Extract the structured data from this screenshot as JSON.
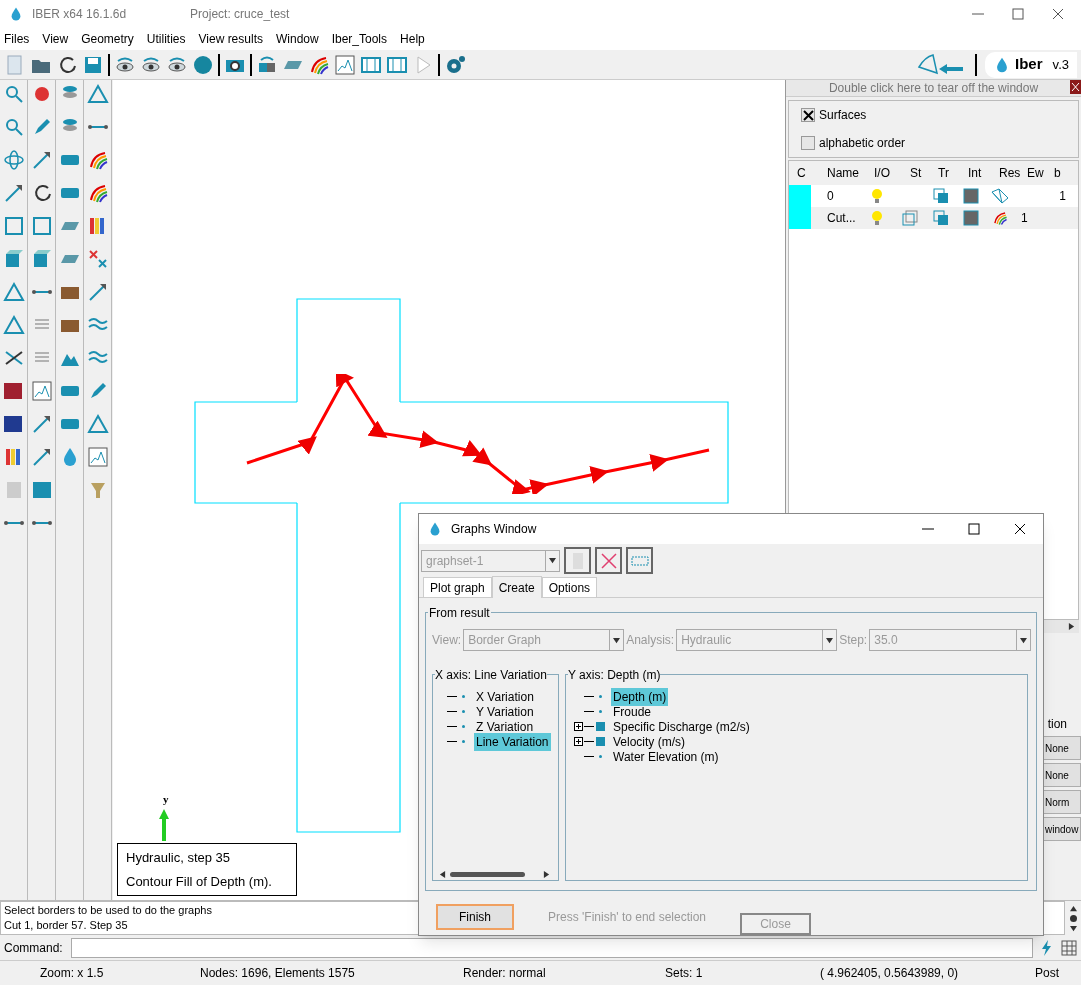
{
  "app": {
    "title": "IBER x64 16.1.6d",
    "project": "Project: cruce_test"
  },
  "menu": [
    "Files",
    "View",
    "Geometry",
    "Utilities",
    "View results",
    "Window",
    "Iber_Tools",
    "Help"
  ],
  "logo": {
    "name": "Iber",
    "version": "v.3"
  },
  "layers_panel": {
    "tear_off": "Double click here to tear off the window",
    "surfaces": {
      "label": "Surfaces",
      "checked": true
    },
    "alphabetic": {
      "label": "alphabetic order",
      "checked": false
    },
    "columns": [
      "C",
      "Name",
      "I/O",
      "St",
      "Tr",
      "Int",
      "Res",
      "Ew",
      "b"
    ],
    "rows": [
      {
        "color": "#00ffff",
        "name": "0",
        "style_icon": false,
        "kind": "mesh",
        "ew": "",
        "b": "1"
      },
      {
        "color": "#00ffff",
        "name": "Cut...",
        "style_icon": true,
        "kind": "rainbow",
        "ew": "1",
        "b": ""
      }
    ],
    "side_label": "tion",
    "side_buttons": [
      "None",
      "None",
      "Norm",
      "window"
    ]
  },
  "canvas": {
    "axis_label": "y",
    "legend": [
      "Hydraulic, step 35",
      "Contour Fill of Depth (m)."
    ]
  },
  "graphs_window": {
    "title": "Graphs Window",
    "graphset": "graphset-1",
    "tabs": [
      {
        "label": "Plot graph",
        "selected": false
      },
      {
        "label": "Create",
        "selected": true
      },
      {
        "label": "Options",
        "selected": false
      }
    ],
    "group": "From result",
    "view": {
      "label": "View:",
      "value": "Border Graph"
    },
    "analysis": {
      "label": "Analysis:",
      "value": "Hydraulic"
    },
    "step": {
      "label": "Step:",
      "value": "35.0"
    },
    "x_axis": {
      "title": "X axis: Line Variation",
      "items": [
        {
          "label": "X Variation",
          "selected": false,
          "kind": "leaf"
        },
        {
          "label": "Y Variation",
          "selected": false,
          "kind": "leaf"
        },
        {
          "label": "Z Variation",
          "selected": false,
          "kind": "leaf"
        },
        {
          "label": "Line Variation",
          "selected": true,
          "kind": "leaf"
        }
      ]
    },
    "y_axis": {
      "title": "Y axis: Depth (m)",
      "items": [
        {
          "label": "Depth (m)",
          "selected": true,
          "kind": "leaf"
        },
        {
          "label": "Froude",
          "selected": false,
          "kind": "leaf"
        },
        {
          "label": "Specific Discharge (m2/s)",
          "selected": false,
          "kind": "group",
          "expanded": false
        },
        {
          "label": "Velocity (m/s)",
          "selected": false,
          "kind": "group",
          "expanded": false
        },
        {
          "label": "Water Elevation (m)",
          "selected": false,
          "kind": "leaf"
        }
      ]
    },
    "finish": "Finish",
    "hint": "Press 'Finish' to end selection",
    "close": "Close"
  },
  "messages": [
    "Select borders to be used to do the graphs",
    "Cut 1, border 57. Step 35"
  ],
  "command": {
    "label": "Command:"
  },
  "status": [
    "Zoom: x 1.5",
    "Nodes: 1696, Elements 1575",
    "Render: normal",
    "Sets: 1",
    "(  4.962405,  0.5643989,  0)",
    "Post"
  ]
}
